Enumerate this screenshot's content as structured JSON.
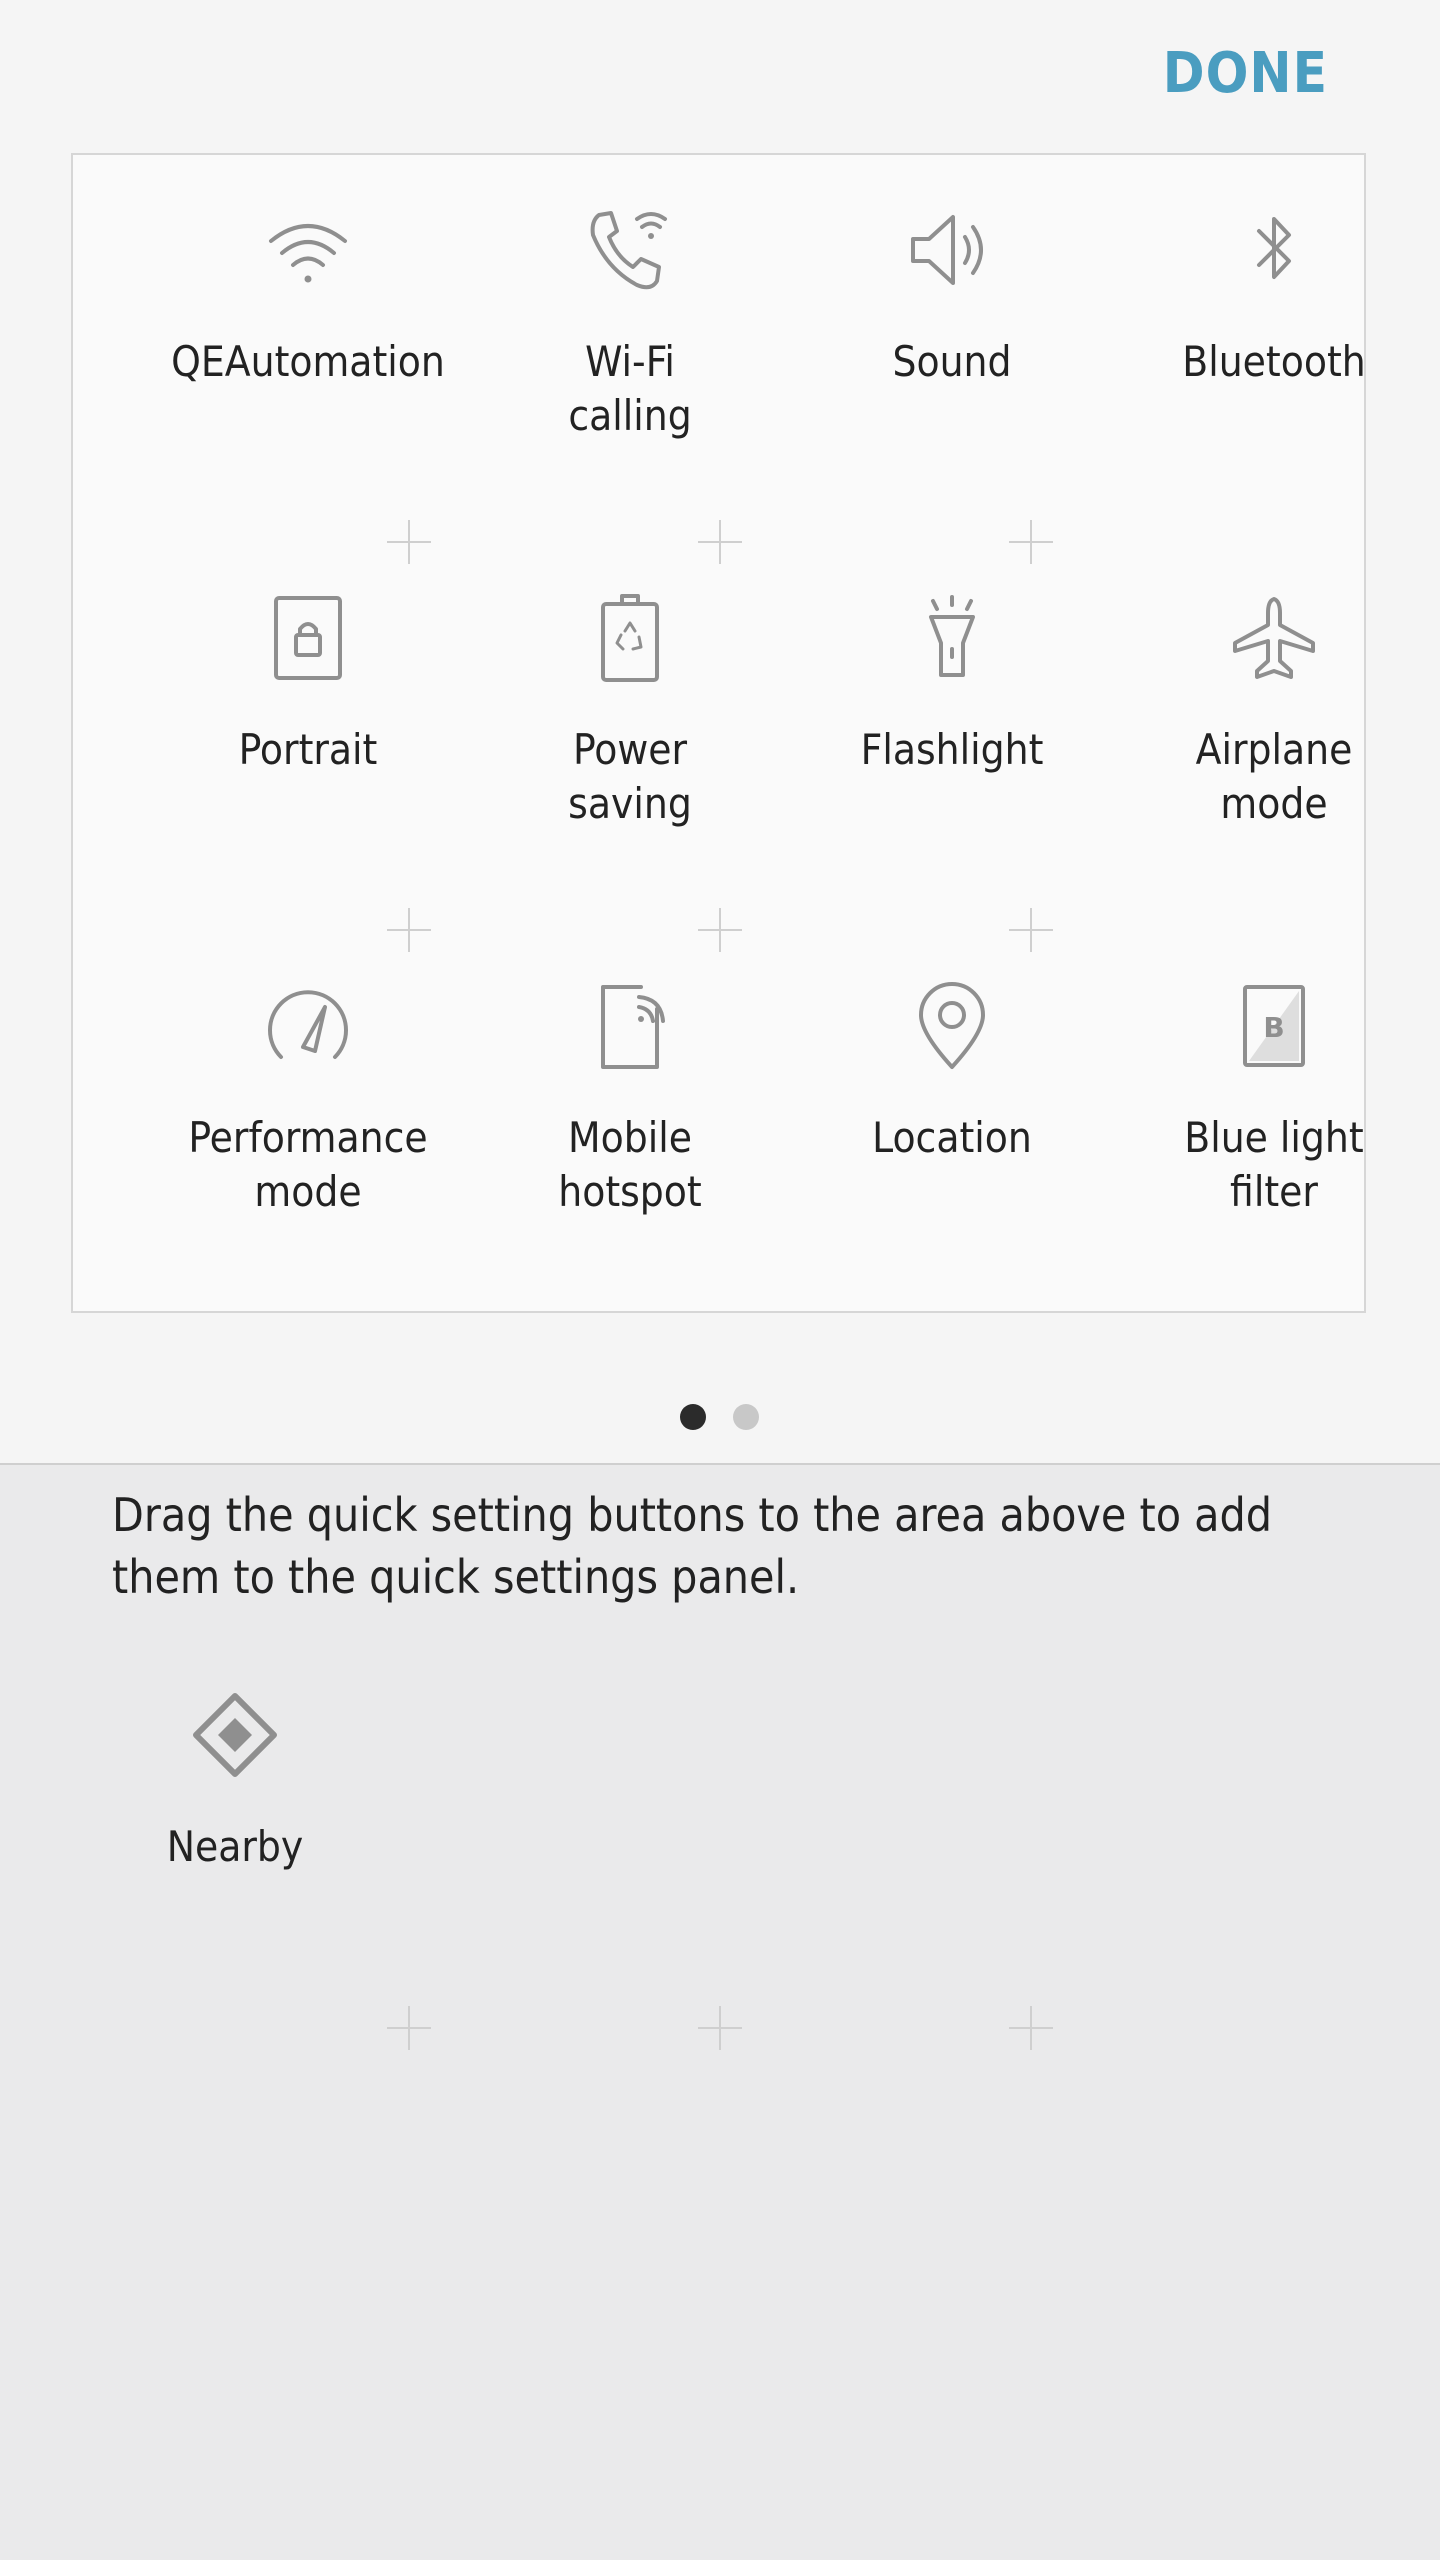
{
  "header": {
    "done_label": "DONE",
    "accent_color": "#4a9dc0"
  },
  "active_tiles": [
    {
      "label": "QEAutomation",
      "icon": "wifi-icon"
    },
    {
      "label": "Wi-Fi\ncalling",
      "icon": "wifi-calling-icon"
    },
    {
      "label": "Sound",
      "icon": "speaker-icon"
    },
    {
      "label": "Bluetooth",
      "icon": "bluetooth-icon"
    },
    {
      "label": "Portrait",
      "icon": "portrait-lock-icon"
    },
    {
      "label": "Power\nsaving",
      "icon": "power-saving-battery-icon"
    },
    {
      "label": "Flashlight",
      "icon": "flashlight-icon"
    },
    {
      "label": "Airplane\nmode",
      "icon": "airplane-icon"
    },
    {
      "label": "Performance\nmode",
      "icon": "speedometer-icon"
    },
    {
      "label": "Mobile\nhotspot",
      "icon": "mobile-hotspot-icon"
    },
    {
      "label": "Location",
      "icon": "location-pin-icon"
    },
    {
      "label": "Blue light\nfilter",
      "icon": "blue-light-filter-icon"
    }
  ],
  "pagination": {
    "pages": 2,
    "current_page": 1
  },
  "available": {
    "instructions": "Drag the quick setting buttons to the area above to add them to the quick settings panel.",
    "tiles": [
      {
        "label": "Nearby",
        "icon": "nearby-diamond-icon"
      }
    ]
  }
}
